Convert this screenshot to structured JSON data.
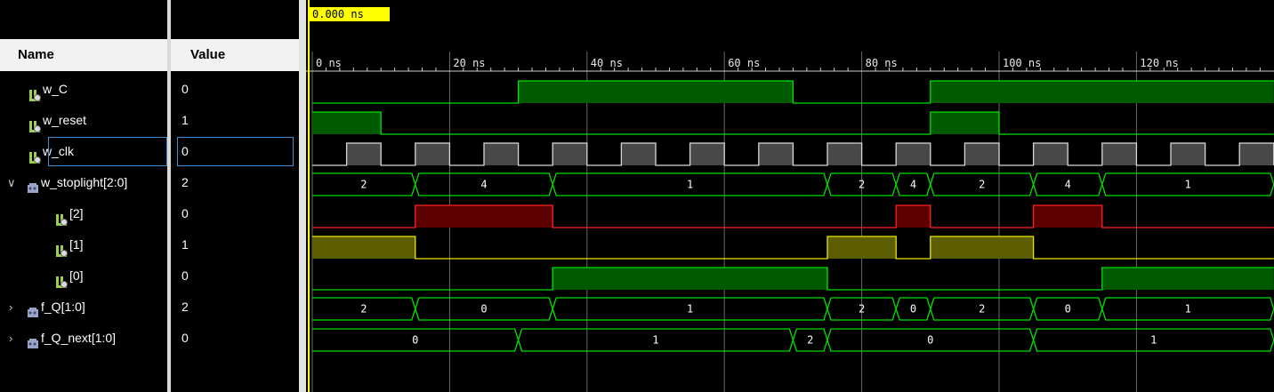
{
  "headers": {
    "name": "Name",
    "value": "Value"
  },
  "cursor_time": "0.000 ns",
  "time_axis": {
    "labels": [
      "0 ns",
      "20 ns",
      "40 ns",
      "60 ns",
      "80 ns",
      "100 ns",
      "120 ns"
    ]
  },
  "signals": [
    {
      "name": "w_C",
      "value": "0",
      "type": "bit",
      "expand": ""
    },
    {
      "name": "w_reset",
      "value": "1",
      "type": "bit",
      "expand": ""
    },
    {
      "name": "w_clk",
      "value": "0",
      "type": "bit",
      "expand": ""
    },
    {
      "name": "w_stoplight[2:0]",
      "value": "2",
      "type": "bus",
      "expand": "expanded"
    },
    {
      "name": "[2]",
      "value": "0",
      "type": "bit",
      "expand": ""
    },
    {
      "name": "[1]",
      "value": "1",
      "type": "bit",
      "expand": ""
    },
    {
      "name": "[0]",
      "value": "0",
      "type": "bit",
      "expand": ""
    },
    {
      "name": "f_Q[1:0]",
      "value": "2",
      "type": "bus",
      "expand": "collapsed"
    },
    {
      "name": "f_Q_next[1:0]",
      "value": "0",
      "type": "bus",
      "expand": "collapsed"
    }
  ],
  "colors": {
    "green_edge": "#00e000",
    "green_fill": "#005a00",
    "red_edge": "#ff2020",
    "red_fill": "#5c0000",
    "yellow_edge": "#e8e800",
    "yellow_fill": "#5c5c00",
    "clk_edge": "#d8d8d8",
    "clk_fill": "#484848",
    "grid": "#6a6a6a",
    "cursor": "#ffff00"
  },
  "waves": {
    "w_C": {
      "color": "green",
      "segments": [
        [
          0,
          30,
          0
        ],
        [
          30,
          70,
          1
        ],
        [
          70,
          90,
          0
        ],
        [
          90,
          140,
          1
        ]
      ]
    },
    "w_reset": {
      "color": "green",
      "segments": [
        [
          0,
          10,
          1
        ],
        [
          10,
          90,
          0
        ],
        [
          90,
          100,
          1
        ],
        [
          100,
          140,
          0
        ]
      ]
    },
    "w_clk": {
      "color": "clk",
      "period": 10,
      "start": 0,
      "end": 140
    },
    "w_stoplight": {
      "segments": [
        [
          0,
          15,
          "2"
        ],
        [
          15,
          35,
          "4"
        ],
        [
          35,
          75,
          "1"
        ],
        [
          75,
          85,
          "2"
        ],
        [
          85,
          90,
          "4"
        ],
        [
          90,
          105,
          "2"
        ],
        [
          105,
          115,
          "4"
        ],
        [
          115,
          140,
          "1"
        ]
      ]
    },
    "bit2": {
      "color": "red",
      "segments": [
        [
          0,
          15,
          0
        ],
        [
          15,
          35,
          1
        ],
        [
          35,
          85,
          0
        ],
        [
          85,
          90,
          1
        ],
        [
          90,
          105,
          0
        ],
        [
          105,
          115,
          1
        ],
        [
          115,
          140,
          0
        ]
      ]
    },
    "bit1": {
      "color": "yellow",
      "segments": [
        [
          0,
          15,
          1
        ],
        [
          15,
          75,
          0
        ],
        [
          75,
          85,
          1
        ],
        [
          85,
          90,
          0
        ],
        [
          90,
          105,
          1
        ],
        [
          105,
          140,
          0
        ]
      ]
    },
    "bit0": {
      "color": "green",
      "segments": [
        [
          0,
          35,
          0
        ],
        [
          35,
          75,
          1
        ],
        [
          75,
          115,
          0
        ],
        [
          115,
          140,
          1
        ]
      ]
    },
    "f_Q": {
      "segments": [
        [
          0,
          15,
          "2"
        ],
        [
          15,
          35,
          "0"
        ],
        [
          35,
          75,
          "1"
        ],
        [
          75,
          85,
          "2"
        ],
        [
          85,
          90,
          "0"
        ],
        [
          90,
          105,
          "2"
        ],
        [
          105,
          115,
          "0"
        ],
        [
          115,
          140,
          "1"
        ]
      ]
    },
    "f_Q_next": {
      "segments": [
        [
          0,
          30,
          "0"
        ],
        [
          30,
          70,
          "1"
        ],
        [
          70,
          75,
          "2"
        ],
        [
          75,
          105,
          "0"
        ],
        [
          105,
          140,
          "1"
        ]
      ]
    }
  }
}
